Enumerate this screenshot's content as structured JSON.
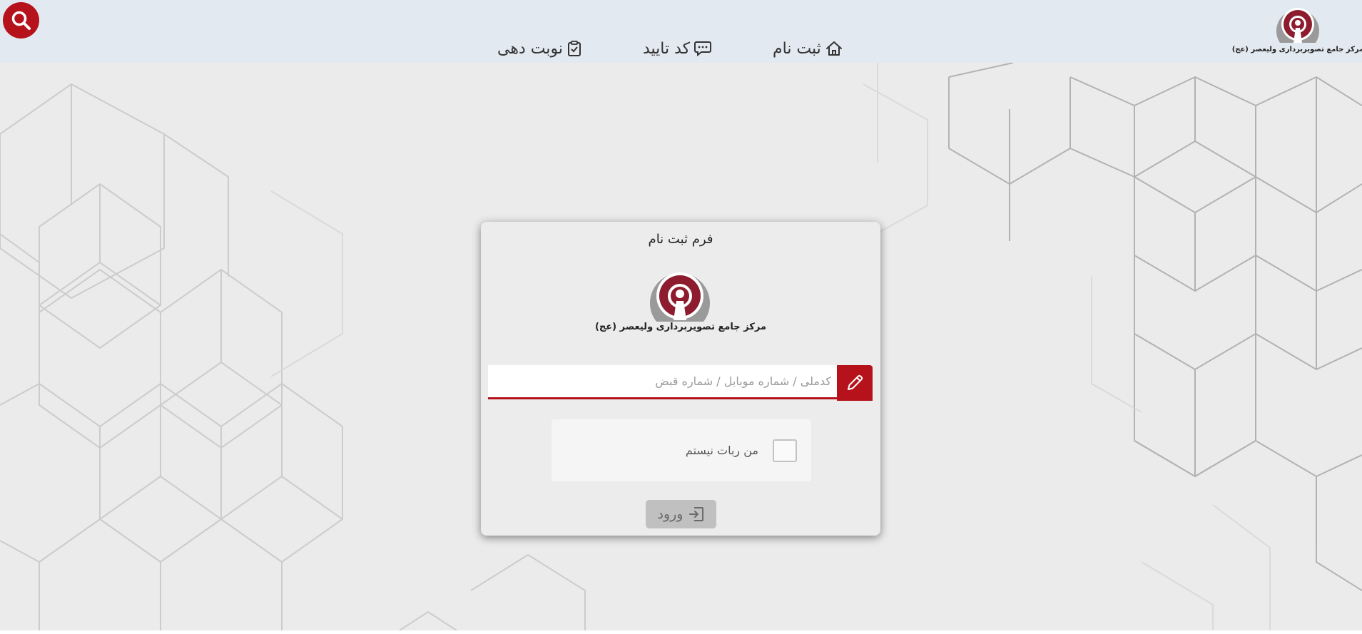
{
  "header": {
    "brand_text": "مرکز جامع تصویربرداری ولیعصر (عج)",
    "nav": [
      {
        "label": "ثبت نام",
        "icon": "home-icon"
      },
      {
        "label": "کد تایید",
        "icon": "chat-icon"
      },
      {
        "label": "نوبت دهی",
        "icon": "clipboard-check-icon"
      }
    ],
    "search_icon": "search-icon",
    "accent_color": "#b5121b"
  },
  "form": {
    "title": "فرم ثبت نام",
    "brand_text": "مرکز جامع تصویربرداری ولیعصر (عج)",
    "input": {
      "placeholder": "کدملی / شماره موبایل / شماره قبض",
      "value": "",
      "icon": "pencil-icon"
    },
    "captcha": {
      "label": "من ربات نیستم",
      "checked": false
    },
    "submit": {
      "label": "ورود",
      "icon": "login-icon"
    }
  }
}
